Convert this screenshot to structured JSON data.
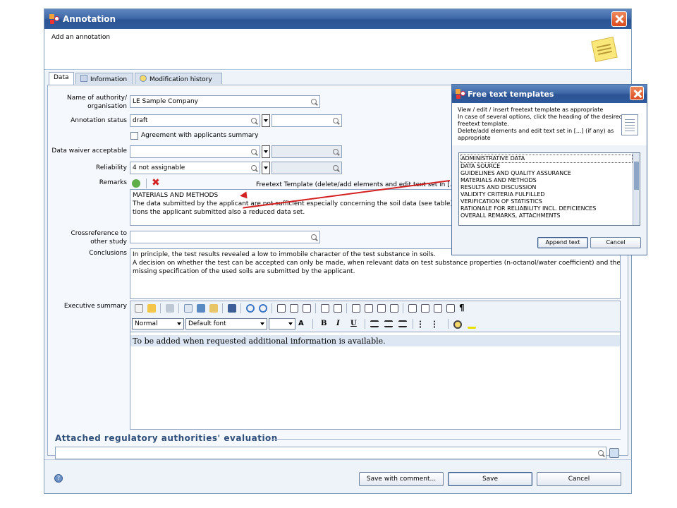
{
  "window": {
    "title": "Annotation",
    "subtitle": "Add an annotation"
  },
  "tabs": [
    "Data",
    "Information",
    "Modification history"
  ],
  "form": {
    "authority_label_1": "Name of authority/",
    "authority_label_2": "organisation",
    "authority_value": "LE Sample Company",
    "status_label": "Annotation status",
    "status_value": "draft",
    "agreement_label": "Agreement with applicants summary",
    "waiver_label": "Data waiver acceptable",
    "reliability_label": "Reliability",
    "reliability_value": "4 not assignable",
    "remarks_label": "Remarks",
    "freetext_label": "Freetext Template (delete/add elements and edit text set in [...",
    "remarks_lines": [
      "MATERIALS AND METHODS",
      "The data submitted by the applicant are not sufficient especially concerning the soil data (see table). F",
      "tions the applicant submitted also a reduced data set."
    ],
    "crossref_label_1": "Crossreference to",
    "crossref_label_2": "other study",
    "conclusions_label": "Conclusions",
    "conclusions_lines": [
      "In principle, the test results revealed a low to immobile character of the test substance in soils.",
      "A decision on whether the test can be accepted can only be made, when relevant data on test substance properties (n-octanol/water coefficient) and the",
      "missing specification of the used soils are submitted by the applicant."
    ],
    "exec_label": "Executive summary",
    "style_select": "Normal",
    "font_select": "Default font",
    "exec_text": "To be added when requested additional information is available.",
    "attached_title": "Attached regulatory authorities' evaluation"
  },
  "buttons": {
    "save_comment": "Save with comment...",
    "save": "Save",
    "cancel": "Cancel"
  },
  "popup": {
    "title": "Free text templates",
    "instructions": [
      "View / edit / insert freetext template as appropriate",
      "In case of several options, click the heading of the desired",
      "freetext template.",
      "Delete/add elements and edit text set in [...] (if any) as",
      "appropriate"
    ],
    "items": [
      "ADMINISTRATIVE DATA",
      "DATA SOURCE",
      "GUIDELINES AND QUALITY ASSURANCE",
      "MATERIALS AND METHODS",
      "RESULTS AND DISCUSSION",
      "VALIDITY CRITERIA FULFILLED",
      "VERIFICATION OF STATISTICS",
      "RATIONALE FOR RELIABILITY INCL. DEFICIENCES",
      "OVERALL REMARKS, ATTACHMENTS"
    ],
    "append": "Append text",
    "cancel": "Cancel"
  },
  "colors": {
    "title_bar": "#2c5494",
    "close": "#d94a1e",
    "arrow": "#d42121",
    "section": "#2f4f7a"
  }
}
